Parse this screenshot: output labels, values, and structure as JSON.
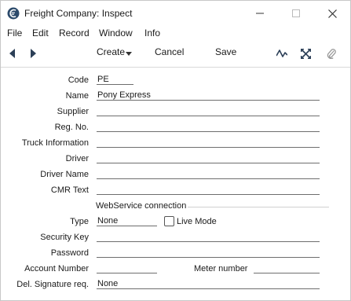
{
  "window": {
    "title": "Freight Company: Inspect"
  },
  "menubar": [
    "File",
    "Edit",
    "Record",
    "Window",
    "Info"
  ],
  "toolbar": {
    "create_label": "Create",
    "cancel_label": "Cancel",
    "save_label": "Save"
  },
  "form": {
    "code": {
      "label": "Code",
      "value": "PE"
    },
    "name": {
      "label": "Name",
      "value": "Pony Express"
    },
    "supplier": {
      "label": "Supplier",
      "value": ""
    },
    "reg_no": {
      "label": "Reg. No.",
      "value": ""
    },
    "truck_information": {
      "label": "Truck Information",
      "value": ""
    },
    "driver": {
      "label": "Driver",
      "value": ""
    },
    "driver_name": {
      "label": "Driver Name",
      "value": ""
    },
    "cmr_text": {
      "label": "CMR Text",
      "value": ""
    },
    "webservice_section": "WebService connection",
    "type": {
      "label": "Type",
      "value": "None"
    },
    "live_mode": {
      "label": "Live Mode",
      "checked": false
    },
    "security_key": {
      "label": "Security Key",
      "value": ""
    },
    "password": {
      "label": "Password",
      "value": ""
    },
    "account_number": {
      "label": "Account Number",
      "value": ""
    },
    "meter_number": {
      "label": "Meter number",
      "value": ""
    },
    "del_signature_req": {
      "label": "Del. Signature req.",
      "value": "None"
    }
  }
}
